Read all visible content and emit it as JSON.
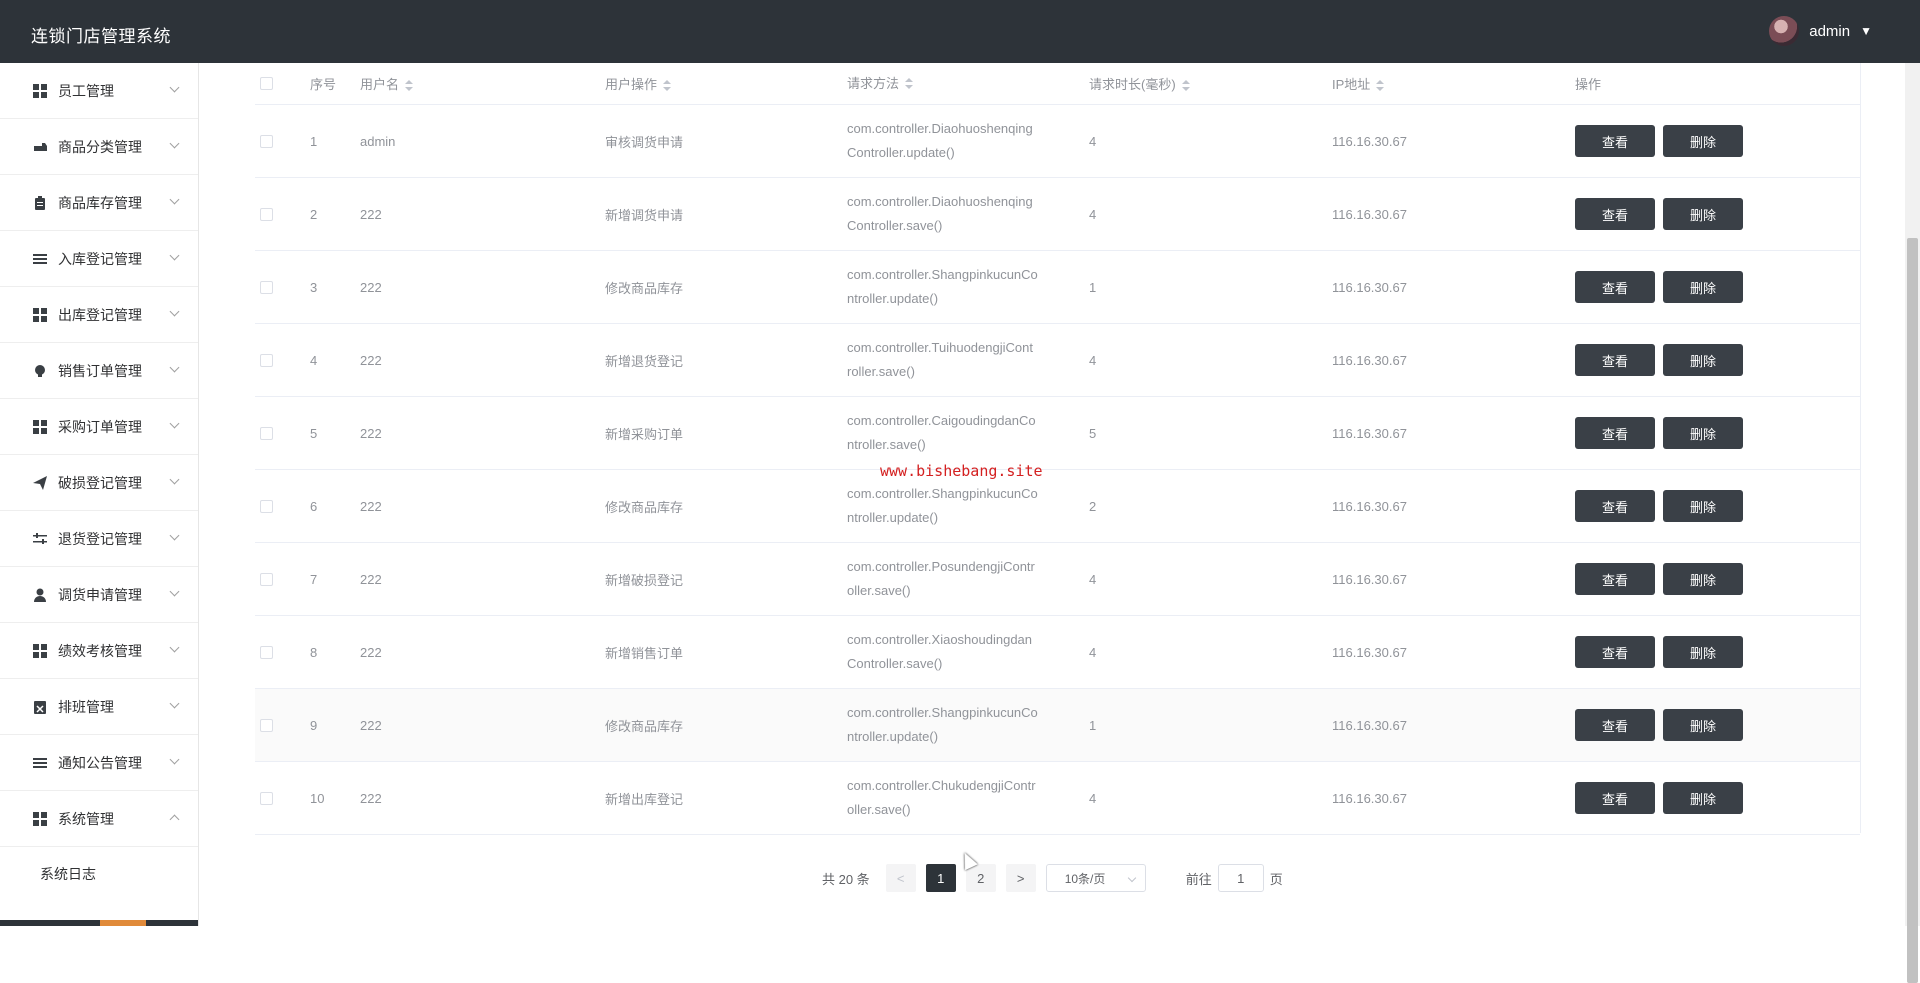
{
  "app": {
    "title": "连锁门店管理系统",
    "user": "admin"
  },
  "sidebar": {
    "items": [
      {
        "label": "员工管理",
        "icon": "grid-icon"
      },
      {
        "label": "商品分类管理",
        "icon": "car-icon"
      },
      {
        "label": "商品库存管理",
        "icon": "clipboard-icon"
      },
      {
        "label": "入库登记管理",
        "icon": "list-icon"
      },
      {
        "label": "出库登记管理",
        "icon": "grid-icon"
      },
      {
        "label": "销售订单管理",
        "icon": "bulb-icon"
      },
      {
        "label": "采购订单管理",
        "icon": "grid-icon"
      },
      {
        "label": "破损登记管理",
        "icon": "send-icon"
      },
      {
        "label": "退货登记管理",
        "icon": "sliders-icon"
      },
      {
        "label": "调货申请管理",
        "icon": "user-icon"
      },
      {
        "label": "绩效考核管理",
        "icon": "grid-icon"
      },
      {
        "label": "排班管理",
        "icon": "calendar-x-icon"
      },
      {
        "label": "通知公告管理",
        "icon": "list-icon"
      },
      {
        "label": "系统管理",
        "icon": "grid-icon"
      }
    ],
    "sub_items": [
      {
        "label": "系统日志"
      }
    ]
  },
  "table": {
    "columns": {
      "no": "序号",
      "user": "用户名",
      "op": "用户操作",
      "method": "请求方法",
      "dur": "请求时长(毫秒)",
      "ip": "IP地址",
      "act": "操作"
    },
    "rows": [
      {
        "no": "1",
        "user": "admin",
        "op": "审核调货申请",
        "method1": "com.controller.Diaohuoshenqing",
        "method2": "Controller.update()",
        "dur": "4",
        "ip": "116.16.30.67"
      },
      {
        "no": "2",
        "user": "222",
        "op": "新增调货申请",
        "method1": "com.controller.Diaohuoshenqing",
        "method2": "Controller.save()",
        "dur": "4",
        "ip": "116.16.30.67"
      },
      {
        "no": "3",
        "user": "222",
        "op": "修改商品库存",
        "method1": "com.controller.ShangpinkucunCo",
        "method2": "ntroller.update()",
        "dur": "1",
        "ip": "116.16.30.67"
      },
      {
        "no": "4",
        "user": "222",
        "op": "新增退货登记",
        "method1": "com.controller.TuihuodengjiCont",
        "method2": "roller.save()",
        "dur": "4",
        "ip": "116.16.30.67"
      },
      {
        "no": "5",
        "user": "222",
        "op": "新增采购订单",
        "method1": "com.controller.CaigoudingdanCo",
        "method2": "ntroller.save()",
        "dur": "5",
        "ip": "116.16.30.67"
      },
      {
        "no": "6",
        "user": "222",
        "op": "修改商品库存",
        "method1": "com.controller.ShangpinkucunCo",
        "method2": "ntroller.update()",
        "dur": "2",
        "ip": "116.16.30.67"
      },
      {
        "no": "7",
        "user": "222",
        "op": "新增破损登记",
        "method1": "com.controller.PosundengjiContr",
        "method2": "oller.save()",
        "dur": "4",
        "ip": "116.16.30.67"
      },
      {
        "no": "8",
        "user": "222",
        "op": "新增销售订单",
        "method1": "com.controller.Xiaoshoudingdan",
        "method2": "Controller.save()",
        "dur": "4",
        "ip": "116.16.30.67"
      },
      {
        "no": "9",
        "user": "222",
        "op": "修改商品库存",
        "method1": "com.controller.ShangpinkucunCo",
        "method2": "ntroller.update()",
        "dur": "1",
        "ip": "116.16.30.67"
      },
      {
        "no": "10",
        "user": "222",
        "op": "新增出库登记",
        "method1": "com.controller.ChukudengjiContr",
        "method2": "oller.save()",
        "dur": "4",
        "ip": "116.16.30.67"
      }
    ],
    "view_label": "查看",
    "delete_label": "删除"
  },
  "watermark": "www.bishebang.site",
  "pagination": {
    "total": "共 20 条",
    "prev": "<",
    "pages": [
      "1",
      "2"
    ],
    "next": ">",
    "page_size": "10条/页",
    "goto_prefix": "前往",
    "goto_value": "1",
    "goto_suffix": "页"
  }
}
